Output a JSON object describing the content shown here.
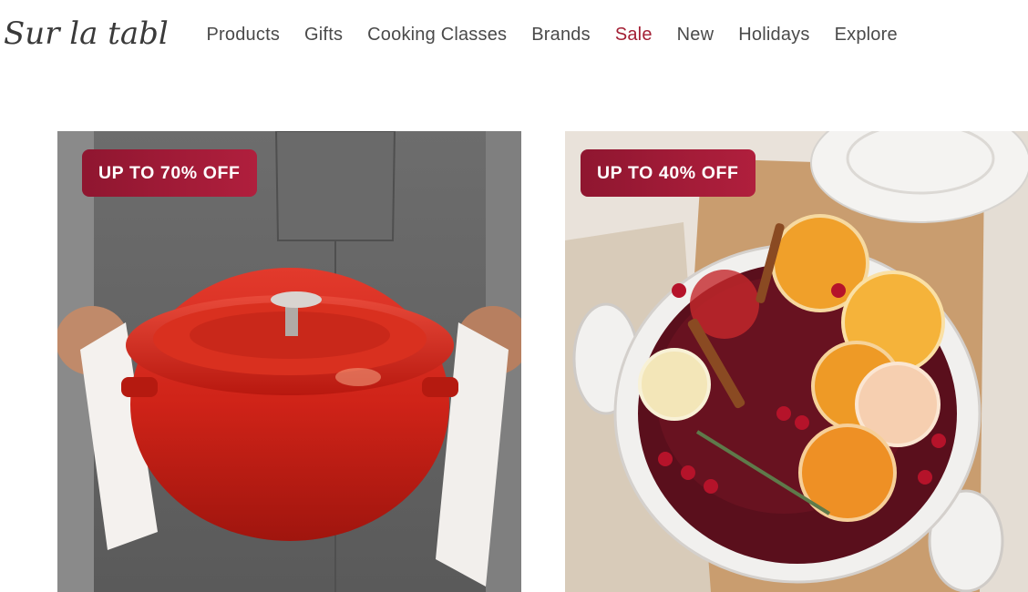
{
  "brand": {
    "logo_text": "Sur la table"
  },
  "nav": {
    "items": [
      {
        "label": "Products"
      },
      {
        "label": "Gifts"
      },
      {
        "label": "Cooking Classes"
      },
      {
        "label": "Brands"
      },
      {
        "label": "Sale"
      },
      {
        "label": "New"
      },
      {
        "label": "Holidays"
      },
      {
        "label": "Explore"
      }
    ],
    "sale_color": "#a31f34"
  },
  "promos": [
    {
      "badge": "UP TO 70% OFF",
      "image": "red-cast-iron-cocotte-held-by-person-in-apron"
    },
    {
      "badge": "UP TO 40% OFF",
      "image": "white-dutch-oven-with-mulled-cider-oranges-cranberries"
    }
  ],
  "colors": {
    "badge_start": "#8f1630",
    "badge_end": "#b01f3d",
    "text": "#4a4a4a"
  }
}
